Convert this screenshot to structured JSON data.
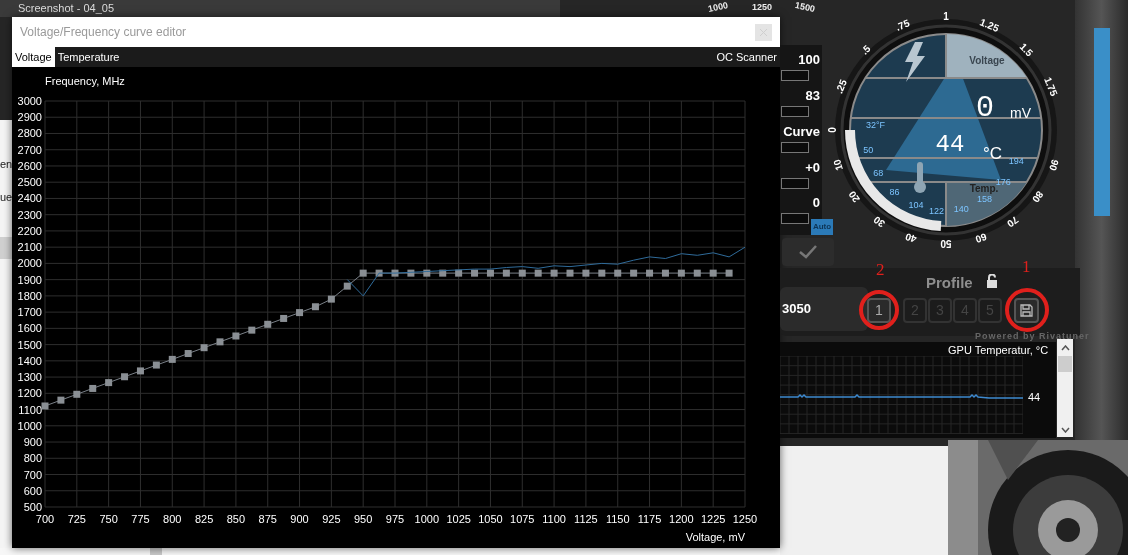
{
  "desktop": {
    "background_title": "Screenshot - 04_05",
    "background_ticks": [
      "1000",
      "1250",
      "1500"
    ],
    "fragments": [
      "en",
      "ue"
    ]
  },
  "editor": {
    "title": "Voltage/Frequency curve editor",
    "tabs": [
      {
        "label": "Voltage",
        "selected": true
      },
      {
        "label": "Temperature",
        "selected": false
      }
    ],
    "oc_scanner": "OC Scanner",
    "chart_data": {
      "type": "line",
      "xlabel": "Voltage, mV",
      "ylabel": "Frequency, MHz",
      "x": [
        700,
        712.5,
        725,
        737.5,
        750,
        762.5,
        775,
        787.5,
        800,
        812.5,
        825,
        837.5,
        850,
        862.5,
        875,
        887.5,
        900,
        912.5,
        925,
        937.5,
        950,
        962.5,
        975,
        987.5,
        1000,
        1012.5,
        1025,
        1037.5,
        1050,
        1062.5,
        1075,
        1087.5,
        1100,
        1112.5,
        1125,
        1137.5,
        1150,
        1162.5,
        1175,
        1187.5,
        1200,
        1212.5,
        1225,
        1237.5,
        1250
      ],
      "series": [
        {
          "marker": "square",
          "color": "#8a8f94",
          "values": [
            1122,
            1158,
            1194,
            1230,
            1266,
            1302,
            1338,
            1374,
            1409,
            1445,
            1481,
            1517,
            1553,
            1589,
            1625,
            1661,
            1697,
            1733,
            1780,
            1860,
            1940,
            1940,
            1940,
            1940,
            1940,
            1940,
            1940,
            1940,
            1940,
            1940,
            1940,
            1940,
            1940,
            1940,
            1940,
            1940,
            1940,
            1940,
            1940,
            1940,
            1940,
            1940,
            1940,
            1940,
            null
          ]
        },
        {
          "color": "#2f6b9a",
          "values": [
            null,
            null,
            null,
            null,
            null,
            null,
            null,
            null,
            null,
            null,
            null,
            null,
            null,
            null,
            null,
            null,
            null,
            null,
            null,
            1900,
            1800,
            1940,
            1940,
            1945,
            1950,
            1955,
            1960,
            1965,
            1965,
            1975,
            1980,
            1970,
            1985,
            1980,
            1990,
            2000,
            1995,
            2020,
            2040,
            2030,
            2060,
            2050,
            2065,
            2040,
            2100
          ]
        }
      ],
      "grid": true,
      "xlim": [
        700,
        1250
      ],
      "ylim": [
        500,
        3000
      ],
      "xticks": [
        700,
        725,
        750,
        775,
        800,
        825,
        850,
        875,
        900,
        925,
        950,
        975,
        1000,
        1025,
        1050,
        1075,
        1100,
        1125,
        1150,
        1175,
        1200,
        1225,
        1250
      ],
      "yticks": [
        500,
        600,
        700,
        800,
        900,
        1000,
        1100,
        1200,
        1300,
        1400,
        1500,
        1600,
        1700,
        1800,
        1900,
        2000,
        2100,
        2200,
        2300,
        2400,
        2500,
        2600,
        2700,
        2800,
        2900,
        3000
      ]
    }
  },
  "readouts": [
    "100",
    "83",
    "Curve",
    "+0",
    "0"
  ],
  "auto_button": "Auto",
  "gauge": {
    "voltage_ticks": [
      "0",
      ".25",
      ".5",
      ".75",
      "1",
      "1.25",
      "1.5",
      "1.75"
    ],
    "temp_ticks": [
      "10",
      "20",
      "30",
      "40",
      "50",
      "60",
      "70",
      "80",
      "90"
    ],
    "fahrenheit_ticks": [
      "32°F",
      "50",
      "68",
      "86",
      "104",
      "122",
      "140",
      "158",
      "176",
      "194"
    ],
    "voltage_label": "Voltage",
    "voltage_value": "0",
    "voltage_unit": "mV",
    "temp_value": "44",
    "temp_unit": "°C",
    "temp_label": "Temp."
  },
  "gpu_name": "3050",
  "profile": {
    "label": "Profile",
    "slots": [
      {
        "label": "1",
        "disabled": false
      },
      {
        "label": "2",
        "disabled": true
      },
      {
        "label": "3",
        "disabled": true
      },
      {
        "label": "4",
        "disabled": true
      },
      {
        "label": "5",
        "disabled": true
      }
    ]
  },
  "powered_by": "Powered by Rivatuner",
  "monitor": {
    "title": "GPU Temperatur, °C",
    "value": "44"
  },
  "annotations": [
    "2",
    "1"
  ]
}
